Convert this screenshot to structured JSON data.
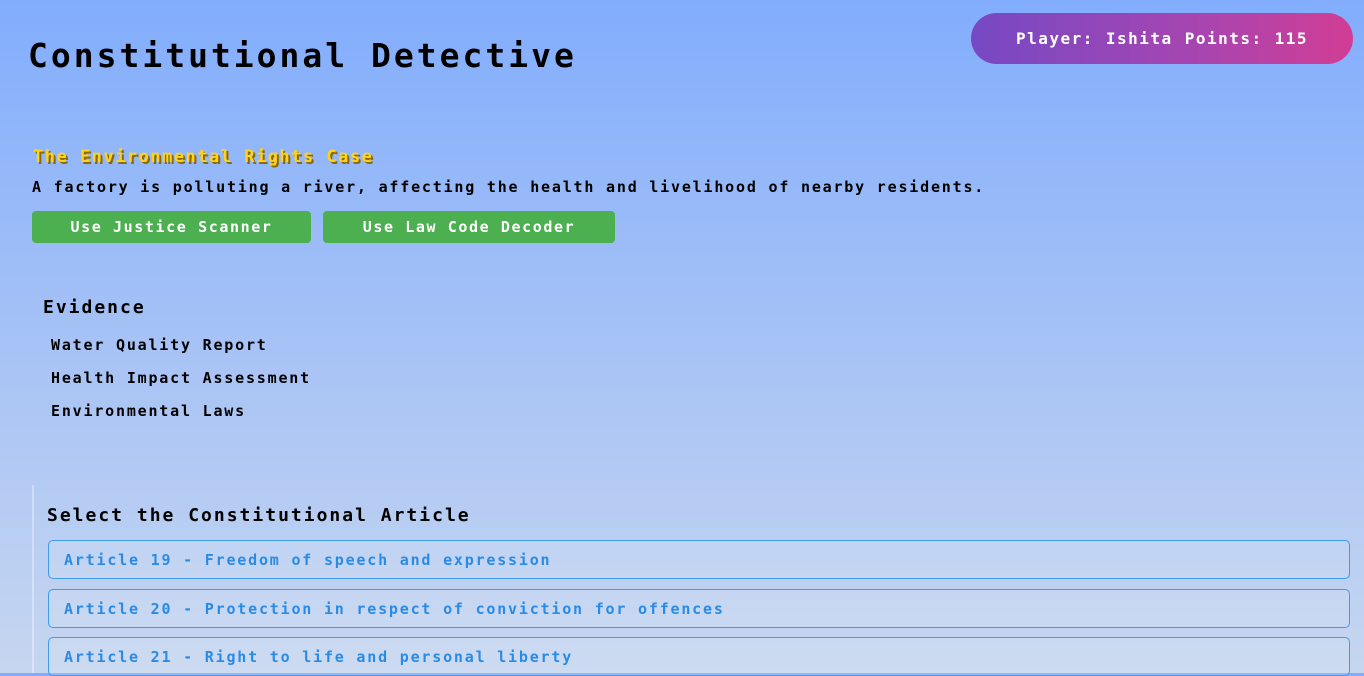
{
  "header": {
    "title": "Constitutional Detective",
    "player_label": "Player:",
    "player_name": "Ishita",
    "points_label": "Points:",
    "points_value": "115"
  },
  "case": {
    "title": "The Environmental Rights Case",
    "description": "A factory is polluting a river, affecting the health and livelihood of nearby residents."
  },
  "tools": {
    "scanner_label": "Use Justice Scanner",
    "decoder_label": "Use Law Code Decoder"
  },
  "evidence": {
    "heading": "Evidence",
    "items": [
      "Water Quality Report",
      "Health Impact Assessment",
      "Environmental Laws"
    ]
  },
  "articles": {
    "heading": "Select the Constitutional Article",
    "options": [
      "Article 19 - Freedom of speech and expression",
      "Article 20 - Protection in respect of conviction for offences",
      "Article 21 - Right to life and personal liberty"
    ]
  },
  "colors": {
    "case_title": "#ffd21f",
    "tool_button": "#4caf50",
    "option_border": "#3b9cf0",
    "option_text": "#2a8be6"
  }
}
